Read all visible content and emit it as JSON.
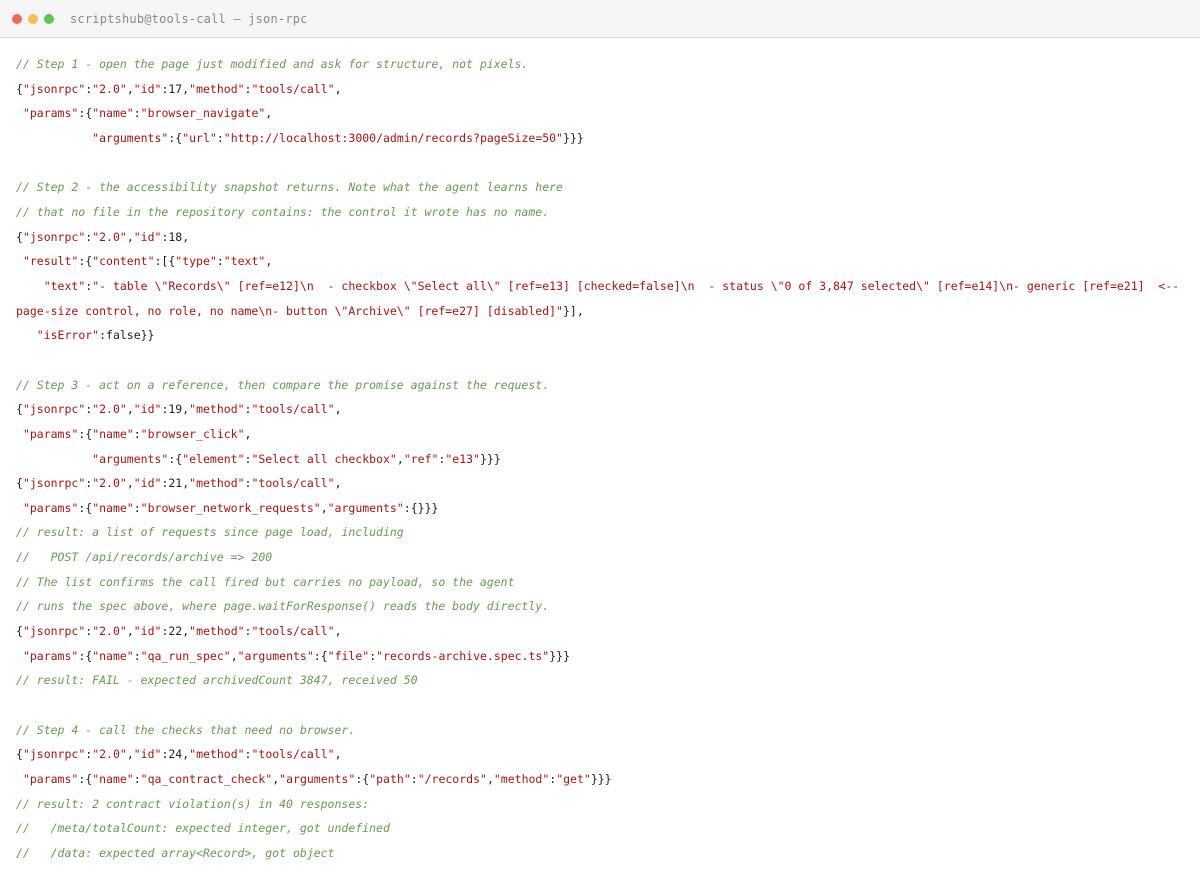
{
  "window": {
    "title": "scriptshub@tools-call — json-rpc",
    "colors": {
      "close": "#ec6a5e",
      "minimize": "#f4bf4f",
      "zoom": "#61c554"
    }
  },
  "code": {
    "lines": [
      [
        {
          "t": "c",
          "v": "// Step 1 - open the page just modified and ask for structure, not pixels."
        }
      ],
      [
        {
          "t": "p",
          "v": "{"
        },
        {
          "t": "s",
          "v": "\"jsonrpc\""
        },
        {
          "t": "p",
          "v": ":"
        },
        {
          "t": "s",
          "v": "\"2.0\""
        },
        {
          "t": "p",
          "v": ","
        },
        {
          "t": "s",
          "v": "\"id\""
        },
        {
          "t": "p",
          "v": ":17,"
        },
        {
          "t": "s",
          "v": "\"method\""
        },
        {
          "t": "p",
          "v": ":"
        },
        {
          "t": "s",
          "v": "\"tools/call\""
        },
        {
          "t": "p",
          "v": ","
        }
      ],
      [
        {
          "t": "p",
          "v": " "
        },
        {
          "t": "s",
          "v": "\"params\""
        },
        {
          "t": "p",
          "v": ":{"
        },
        {
          "t": "s",
          "v": "\"name\""
        },
        {
          "t": "p",
          "v": ":"
        },
        {
          "t": "s",
          "v": "\"browser_navigate\""
        },
        {
          "t": "p",
          "v": ","
        }
      ],
      [
        {
          "t": "p",
          "v": "           "
        },
        {
          "t": "s",
          "v": "\"arguments\""
        },
        {
          "t": "p",
          "v": ":{"
        },
        {
          "t": "s",
          "v": "\"url\""
        },
        {
          "t": "p",
          "v": ":"
        },
        {
          "t": "s",
          "v": "\"http://localhost:3000/admin/records?pageSize=50\""
        },
        {
          "t": "p",
          "v": "}}}"
        }
      ],
      [],
      [
        {
          "t": "c",
          "v": "// Step 2 - the accessibility snapshot returns. Note what the agent learns here"
        }
      ],
      [
        {
          "t": "c",
          "v": "// that no file in the repository contains: the control it wrote has no name."
        }
      ],
      [
        {
          "t": "p",
          "v": "{"
        },
        {
          "t": "s",
          "v": "\"jsonrpc\""
        },
        {
          "t": "p",
          "v": ":"
        },
        {
          "t": "s",
          "v": "\"2.0\""
        },
        {
          "t": "p",
          "v": ","
        },
        {
          "t": "s",
          "v": "\"id\""
        },
        {
          "t": "p",
          "v": ":18,"
        }
      ],
      [
        {
          "t": "p",
          "v": " "
        },
        {
          "t": "s",
          "v": "\"result\""
        },
        {
          "t": "p",
          "v": ":{"
        },
        {
          "t": "s",
          "v": "\"content\""
        },
        {
          "t": "p",
          "v": ":[{"
        },
        {
          "t": "s",
          "v": "\"type\""
        },
        {
          "t": "p",
          "v": ":"
        },
        {
          "t": "s",
          "v": "\"text\""
        },
        {
          "t": "p",
          "v": ","
        }
      ],
      [
        {
          "t": "p",
          "v": "    "
        },
        {
          "t": "s",
          "v": "\"text\""
        },
        {
          "t": "p",
          "v": ":"
        },
        {
          "t": "s",
          "v": "\"- table \\\"Records\\\" [ref=e12]\\n  - checkbox \\\"Select all\\\" [ref=e13] [checked=false]\\n  - status \\\"0 of 3,847 selected\\\" [ref=e14]\\n- generic [ref=e21]  <-- page-size control, no role, no name\\n- button \\\"Archive\\\" [ref=e27] [disabled]\""
        },
        {
          "t": "p",
          "v": "}],"
        }
      ],
      [
        {
          "t": "p",
          "v": "   "
        },
        {
          "t": "s",
          "v": "\"isError\""
        },
        {
          "t": "p",
          "v": ":false}}"
        }
      ],
      [],
      [
        {
          "t": "c",
          "v": "// Step 3 - act on a reference, then compare the promise against the request."
        }
      ],
      [
        {
          "t": "p",
          "v": "{"
        },
        {
          "t": "s",
          "v": "\"jsonrpc\""
        },
        {
          "t": "p",
          "v": ":"
        },
        {
          "t": "s",
          "v": "\"2.0\""
        },
        {
          "t": "p",
          "v": ","
        },
        {
          "t": "s",
          "v": "\"id\""
        },
        {
          "t": "p",
          "v": ":19,"
        },
        {
          "t": "s",
          "v": "\"method\""
        },
        {
          "t": "p",
          "v": ":"
        },
        {
          "t": "s",
          "v": "\"tools/call\""
        },
        {
          "t": "p",
          "v": ","
        }
      ],
      [
        {
          "t": "p",
          "v": " "
        },
        {
          "t": "s",
          "v": "\"params\""
        },
        {
          "t": "p",
          "v": ":{"
        },
        {
          "t": "s",
          "v": "\"name\""
        },
        {
          "t": "p",
          "v": ":"
        },
        {
          "t": "s",
          "v": "\"browser_click\""
        },
        {
          "t": "p",
          "v": ","
        }
      ],
      [
        {
          "t": "p",
          "v": "           "
        },
        {
          "t": "s",
          "v": "\"arguments\""
        },
        {
          "t": "p",
          "v": ":{"
        },
        {
          "t": "s",
          "v": "\"element\""
        },
        {
          "t": "p",
          "v": ":"
        },
        {
          "t": "s",
          "v": "\"Select all checkbox\""
        },
        {
          "t": "p",
          "v": ","
        },
        {
          "t": "s",
          "v": "\"ref\""
        },
        {
          "t": "p",
          "v": ":"
        },
        {
          "t": "s",
          "v": "\"e13\""
        },
        {
          "t": "p",
          "v": "}}}"
        }
      ],
      [
        {
          "t": "p",
          "v": "{"
        },
        {
          "t": "s",
          "v": "\"jsonrpc\""
        },
        {
          "t": "p",
          "v": ":"
        },
        {
          "t": "s",
          "v": "\"2.0\""
        },
        {
          "t": "p",
          "v": ","
        },
        {
          "t": "s",
          "v": "\"id\""
        },
        {
          "t": "p",
          "v": ":21,"
        },
        {
          "t": "s",
          "v": "\"method\""
        },
        {
          "t": "p",
          "v": ":"
        },
        {
          "t": "s",
          "v": "\"tools/call\""
        },
        {
          "t": "p",
          "v": ","
        }
      ],
      [
        {
          "t": "p",
          "v": " "
        },
        {
          "t": "s",
          "v": "\"params\""
        },
        {
          "t": "p",
          "v": ":{"
        },
        {
          "t": "s",
          "v": "\"name\""
        },
        {
          "t": "p",
          "v": ":"
        },
        {
          "t": "s",
          "v": "\"browser_network_requests\""
        },
        {
          "t": "p",
          "v": ","
        },
        {
          "t": "s",
          "v": "\"arguments\""
        },
        {
          "t": "p",
          "v": ":{}}}"
        }
      ],
      [
        {
          "t": "c",
          "v": "// result: a list of requests since page load, including"
        }
      ],
      [
        {
          "t": "c",
          "v": "//   POST /api/records/archive => 200"
        }
      ],
      [
        {
          "t": "c",
          "v": "// The list confirms the call fired but carries no payload, so the agent"
        }
      ],
      [
        {
          "t": "c",
          "v": "// runs the spec above, where page.waitForResponse() reads the body directly."
        }
      ],
      [
        {
          "t": "p",
          "v": "{"
        },
        {
          "t": "s",
          "v": "\"jsonrpc\""
        },
        {
          "t": "p",
          "v": ":"
        },
        {
          "t": "s",
          "v": "\"2.0\""
        },
        {
          "t": "p",
          "v": ","
        },
        {
          "t": "s",
          "v": "\"id\""
        },
        {
          "t": "p",
          "v": ":22,"
        },
        {
          "t": "s",
          "v": "\"method\""
        },
        {
          "t": "p",
          "v": ":"
        },
        {
          "t": "s",
          "v": "\"tools/call\""
        },
        {
          "t": "p",
          "v": ","
        }
      ],
      [
        {
          "t": "p",
          "v": " "
        },
        {
          "t": "s",
          "v": "\"params\""
        },
        {
          "t": "p",
          "v": ":{"
        },
        {
          "t": "s",
          "v": "\"name\""
        },
        {
          "t": "p",
          "v": ":"
        },
        {
          "t": "s",
          "v": "\"qa_run_spec\""
        },
        {
          "t": "p",
          "v": ","
        },
        {
          "t": "s",
          "v": "\"arguments\""
        },
        {
          "t": "p",
          "v": ":{"
        },
        {
          "t": "s",
          "v": "\"file\""
        },
        {
          "t": "p",
          "v": ":"
        },
        {
          "t": "s",
          "v": "\"records-archive.spec.ts\""
        },
        {
          "t": "p",
          "v": "}}}"
        }
      ],
      [
        {
          "t": "c",
          "v": "// result: FAIL - expected archivedCount 3847, received 50"
        }
      ],
      [],
      [
        {
          "t": "c",
          "v": "// Step 4 - call the checks that need no browser."
        }
      ],
      [
        {
          "t": "p",
          "v": "{"
        },
        {
          "t": "s",
          "v": "\"jsonrpc\""
        },
        {
          "t": "p",
          "v": ":"
        },
        {
          "t": "s",
          "v": "\"2.0\""
        },
        {
          "t": "p",
          "v": ","
        },
        {
          "t": "s",
          "v": "\"id\""
        },
        {
          "t": "p",
          "v": ":24,"
        },
        {
          "t": "s",
          "v": "\"method\""
        },
        {
          "t": "p",
          "v": ":"
        },
        {
          "t": "s",
          "v": "\"tools/call\""
        },
        {
          "t": "p",
          "v": ","
        }
      ],
      [
        {
          "t": "p",
          "v": " "
        },
        {
          "t": "s",
          "v": "\"params\""
        },
        {
          "t": "p",
          "v": ":{"
        },
        {
          "t": "s",
          "v": "\"name\""
        },
        {
          "t": "p",
          "v": ":"
        },
        {
          "t": "s",
          "v": "\"qa_contract_check\""
        },
        {
          "t": "p",
          "v": ","
        },
        {
          "t": "s",
          "v": "\"arguments\""
        },
        {
          "t": "p",
          "v": ":{"
        },
        {
          "t": "s",
          "v": "\"path\""
        },
        {
          "t": "p",
          "v": ":"
        },
        {
          "t": "s",
          "v": "\"/records\""
        },
        {
          "t": "p",
          "v": ","
        },
        {
          "t": "s",
          "v": "\"method\""
        },
        {
          "t": "p",
          "v": ":"
        },
        {
          "t": "s",
          "v": "\"get\""
        },
        {
          "t": "p",
          "v": "}}}"
        }
      ],
      [
        {
          "t": "c",
          "v": "// result: 2 contract violation(s) in 40 responses:"
        }
      ],
      [
        {
          "t": "c",
          "v": "//   /meta/totalCount: expected integer, got undefined"
        }
      ],
      [
        {
          "t": "c",
          "v": "//   /data: expected array<Record>, got object"
        }
      ]
    ]
  }
}
